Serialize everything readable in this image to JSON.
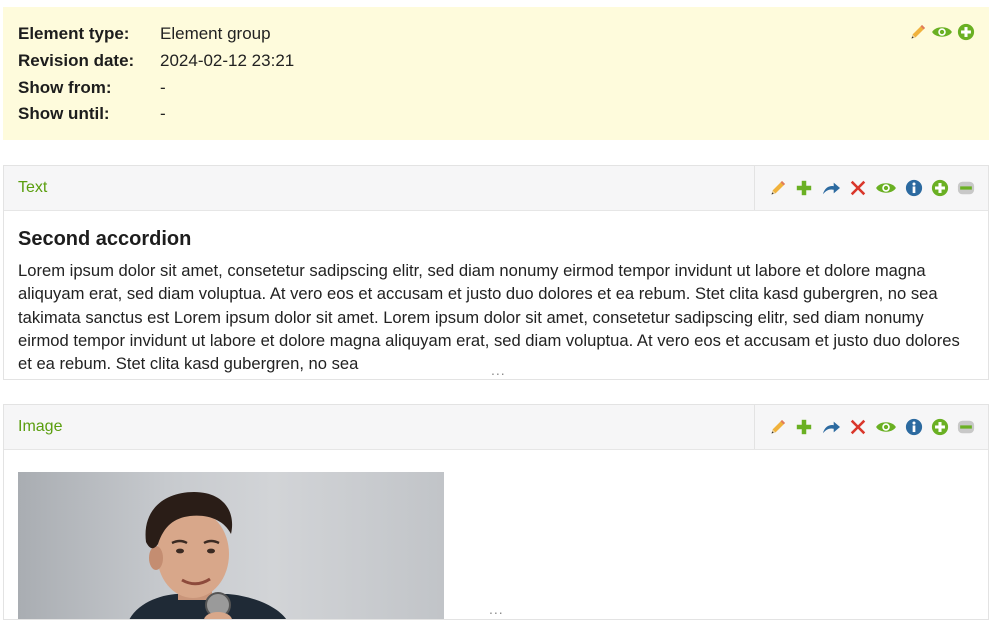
{
  "info_panel": {
    "rows": [
      {
        "label": "Element type:",
        "value": "Element group"
      },
      {
        "label": "Revision date:",
        "value": "2024-02-12 23:21"
      },
      {
        "label": "Show from:",
        "value": "-"
      },
      {
        "label": "Show until:",
        "value": "-"
      }
    ],
    "icons": [
      "pencil-icon",
      "eye-icon",
      "plus-circle-icon"
    ]
  },
  "elements": [
    {
      "title": "Text",
      "heading": "Second accordion",
      "body": "Lorem ipsum dolor sit amet, consetetur sadipscing elitr, sed diam nonumy eirmod tempor invidunt ut labore et dolore magna aliquyam erat, sed diam voluptua. At vero eos et accusam et justo duo dolores et ea rebum. Stet clita kasd gubergren, no sea takimata sanctus est Lorem ipsum dolor sit amet. Lorem ipsum dolor sit amet, consetetur sadipscing elitr, sed diam nonumy eirmod tempor invidunt ut labore et dolore magna aliquyam erat, sed diam voluptua. At vero eos et accusam et justo duo dolores et ea rebum. Stet clita kasd gubergren, no sea",
      "more": "...",
      "tools": [
        "pencil-icon",
        "plus-icon",
        "move-icon",
        "delete-icon",
        "eye-icon",
        "info-icon",
        "plus-circle-icon",
        "minus-icon"
      ]
    },
    {
      "title": "Image",
      "more": "...",
      "tools": [
        "pencil-icon",
        "plus-icon",
        "move-icon",
        "delete-icon",
        "eye-icon",
        "info-icon",
        "plus-circle-icon",
        "minus-icon"
      ]
    }
  ],
  "colors": {
    "info_bg": "#fefbdc",
    "title_green": "#5a9e0e",
    "icon_green": "#6ab023",
    "icon_orange": "#e8a93a",
    "icon_blue": "#2c6aa0",
    "icon_red": "#d9362b"
  }
}
